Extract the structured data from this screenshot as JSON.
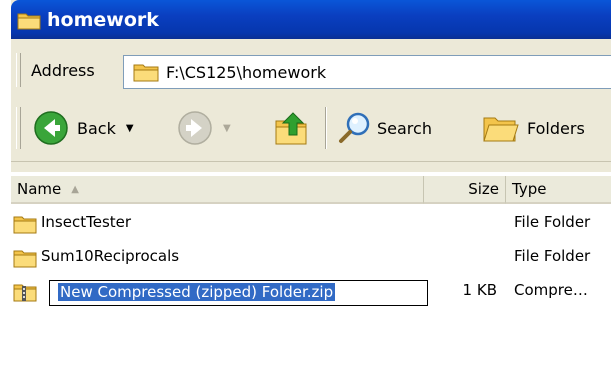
{
  "window": {
    "title": "homework"
  },
  "address_bar": {
    "label": "Address",
    "value": "F:\\CS125\\homework"
  },
  "toolbar": {
    "back_label": "Back",
    "search_label": "Search",
    "folders_label": "Folders"
  },
  "list": {
    "columns": {
      "name": "Name",
      "size": "Size",
      "type": "Type"
    },
    "rows": [
      {
        "name": "InsectTester",
        "size": "",
        "type": "File Folder"
      },
      {
        "name": "Sum10Reciprocals",
        "size": "",
        "type": "File Folder"
      },
      {
        "name": "New Compressed (zipped) Folder.zip",
        "size": "1 KB",
        "type": "Compre…"
      }
    ]
  },
  "colors": {
    "titlebar": "#0a3fc0",
    "chrome": "#ece9d8",
    "selection": "#316ac5"
  }
}
